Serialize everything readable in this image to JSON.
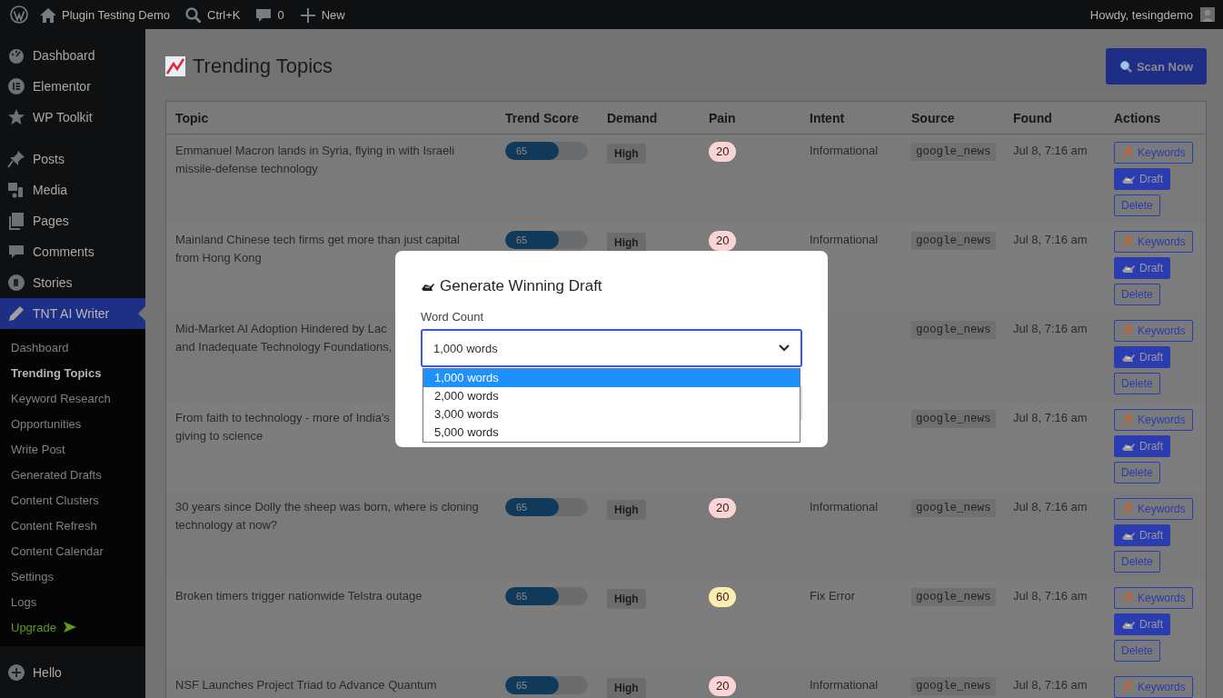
{
  "admin_bar": {
    "site_name": "Plugin Testing Demo",
    "search_shortcut": "Ctrl+K",
    "comments_count": "0",
    "new_label": "New",
    "greeting": "Howdy, tesingdemo"
  },
  "sidebar": {
    "groups": [
      {
        "items": [
          {
            "label": "Dashboard",
            "selected": false
          },
          {
            "label": "Elementor",
            "selected": false
          },
          {
            "label": "WP Toolkit",
            "selected": false
          }
        ]
      },
      {
        "items": [
          {
            "label": "Posts",
            "selected": false
          },
          {
            "label": "Media",
            "selected": false
          },
          {
            "label": "Pages",
            "selected": false
          },
          {
            "label": "Comments",
            "selected": false
          },
          {
            "label": "Stories",
            "selected": false
          },
          {
            "label": "TNT AI Writer",
            "selected": true,
            "children": [
              {
                "label": "Dashboard",
                "kind": "link",
                "selected": false
              },
              {
                "label": "Trending Topics",
                "kind": "link",
                "selected": true
              },
              {
                "label": "Keyword Research",
                "kind": "link",
                "selected": false
              },
              {
                "label": "Opportunities",
                "kind": "link",
                "selected": false
              },
              {
                "label": "Write Post",
                "kind": "link",
                "selected": false
              },
              {
                "label": "Generated Drafts",
                "kind": "link",
                "selected": false
              },
              {
                "label": "Content Clusters",
                "kind": "link",
                "selected": false
              },
              {
                "label": "Content Refresh",
                "kind": "link",
                "selected": false
              },
              {
                "label": "Content Calendar",
                "kind": "link",
                "selected": false
              },
              {
                "label": "Settings",
                "kind": "link",
                "selected": false
              },
              {
                "label": "Logs",
                "kind": "link",
                "selected": false
              },
              {
                "label": "Upgrade",
                "kind": "upgrade",
                "selected": false
              }
            ]
          }
        ]
      },
      {
        "items": [
          {
            "label": "Hello",
            "selected": false
          }
        ]
      }
    ]
  },
  "page": {
    "title": "Trending Topics",
    "scan_button": "Scan Now",
    "columns": [
      "Topic",
      "Trend Score",
      "Demand",
      "Pain",
      "Intent",
      "Source",
      "Found",
      "Actions"
    ],
    "rows": [
      {
        "topic": [
          "Emmanuel Macron lands in Syria, flying in with Israeli",
          "missile-defense technology"
        ],
        "trend": {
          "score": "65",
          "level": 0.65
        },
        "demand": "High",
        "pain": {
          "value": "20",
          "color": "#fbd5d5"
        },
        "intent": "Informational",
        "source": "google_news",
        "found": "Jul 8, 7:16 am",
        "actions": [
          {
            "kind": "keywords",
            "label": "Keywords"
          },
          {
            "kind": "draft",
            "label": "Draft"
          },
          {
            "kind": "delete",
            "label": "Delete"
          }
        ]
      },
      {
        "topic": [
          "Mainland Chinese tech firms get more than just capital",
          "from Hong Kong"
        ],
        "trend": {
          "score": "65",
          "level": 0.65
        },
        "demand": "High",
        "pain": {
          "value": "20",
          "color": "#fbd5d5"
        },
        "intent": "Informational",
        "source": "google_news",
        "found": "Jul 8, 7:16 am",
        "actions": [
          {
            "kind": "keywords",
            "label": "Keywords"
          },
          {
            "kind": "draft",
            "label": "Draft"
          },
          {
            "kind": "delete",
            "label": "Delete"
          }
        ]
      },
      {
        "topic": [
          "Mid-Market AI Adoption Hindered by Lac",
          "and Inadequate Technology Foundations,"
        ],
        "source": "google_news",
        "found": "Jul 8, 7:16 am",
        "actions": [
          {
            "kind": "keywords",
            "label": "Keywords"
          },
          {
            "kind": "draft",
            "label": "Draft"
          },
          {
            "kind": "delete",
            "label": "Delete"
          }
        ]
      },
      {
        "topic": [
          "From faith to technology - more of India's",
          "giving to science"
        ],
        "source": "google_news",
        "found": "Jul 8, 7:16 am",
        "actions": [
          {
            "kind": "keywords",
            "label": "Keywords"
          },
          {
            "kind": "draft",
            "label": "Draft"
          },
          {
            "kind": "delete",
            "label": "Delete"
          }
        ]
      },
      {
        "topic": [
          "30 years since Dolly the sheep was born, where is cloning",
          "technology at now?"
        ],
        "trend": {
          "score": "65",
          "level": 0.65
        },
        "demand": "High",
        "pain": {
          "value": "20",
          "color": "#fbd5d5"
        },
        "intent": "Informational",
        "source": "google_news",
        "found": "Jul 8, 7:16 am",
        "actions": [
          {
            "kind": "keywords",
            "label": "Keywords"
          },
          {
            "kind": "draft",
            "label": "Draft"
          },
          {
            "kind": "delete",
            "label": "Delete"
          }
        ]
      },
      {
        "topic": [
          "Broken timers trigger nationwide Telstra outage"
        ],
        "trend": {
          "score": "65",
          "level": 0.65
        },
        "demand": "High",
        "pain": {
          "value": "60",
          "color": "#fbeeb0"
        },
        "intent": "Fix Error",
        "source": "google_news",
        "found": "Jul 8, 7:16 am",
        "actions": [
          {
            "kind": "keywords",
            "label": "Keywords"
          },
          {
            "kind": "draft",
            "label": "Draft"
          },
          {
            "kind": "delete",
            "label": "Delete"
          }
        ]
      },
      {
        "topic": [
          "NSF Launches Project Triad to Advance Quantum"
        ],
        "trend": {
          "score": "65",
          "level": 0.65
        },
        "demand": "High",
        "pain": {
          "value": "20",
          "color": "#fbd5d5"
        },
        "intent": "Informational",
        "source": "google_news",
        "found": "Jul 8, 7:16 am",
        "actions": [
          {
            "kind": "keywords",
            "label": "Keywords"
          }
        ]
      }
    ]
  },
  "modal": {
    "title": "Generate Winning Draft",
    "field_label": "Word Count",
    "value": "1,000 words",
    "options": [
      {
        "label": "1,000 words",
        "selected": true
      },
      {
        "label": "2,000 words",
        "selected": false
      },
      {
        "label": "3,000 words",
        "selected": false
      },
      {
        "label": "5,000 words",
        "selected": false
      }
    ]
  }
}
